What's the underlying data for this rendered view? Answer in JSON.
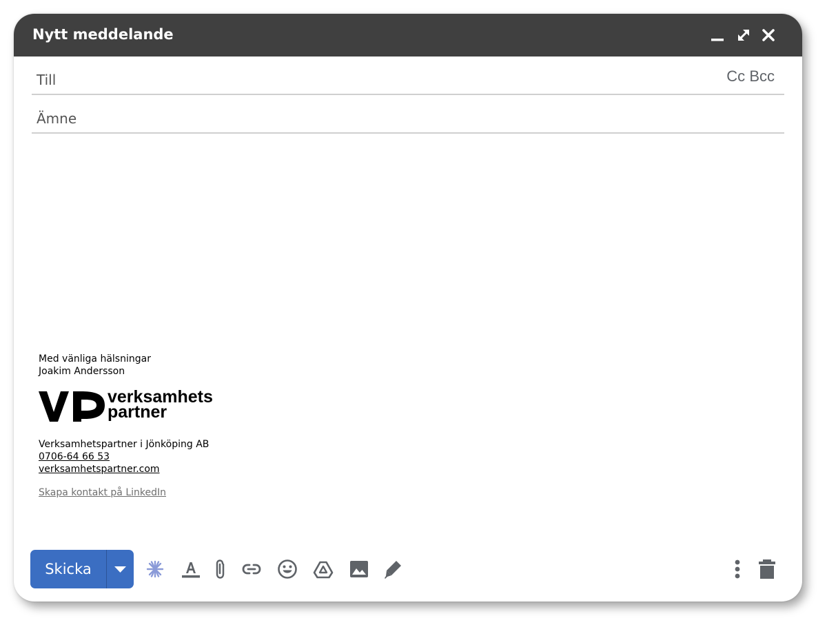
{
  "window": {
    "title": "Nytt meddelande",
    "controls": {
      "minimize": "minimize-icon",
      "expand": "expand-icon",
      "close": "close-icon"
    }
  },
  "fields": {
    "to_label": "Till",
    "cc_label": "Cc",
    "bcc_label": "Bcc",
    "subject_label": "Ämne"
  },
  "signature": {
    "greeting": "Med vänliga hälsningar",
    "name": "Joakim Andersson",
    "logo_text_line1": "verksamhets",
    "logo_text_line2": "partner",
    "company": "Verksamhetspartner i Jönköping AB",
    "phone": "0706-64 66 53",
    "website": "verksamhetspartner.com",
    "linkedin": "Skapa kontakt på LinkedIn"
  },
  "toolbar": {
    "send_label": "Skicka",
    "icons": [
      "send-options-icon",
      "sparkle-icon",
      "text-format-icon",
      "attach-icon",
      "link-icon",
      "emoji-icon",
      "drive-icon",
      "image-icon",
      "signature-pen-icon",
      "more-options-icon",
      "trash-icon"
    ]
  },
  "colors": {
    "titlebar": "#404040",
    "send_button": "#3b6ec2",
    "icon": "#5f6368",
    "sparkle": "#8a9ad8"
  }
}
